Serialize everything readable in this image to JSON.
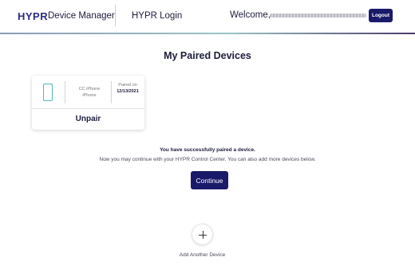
{
  "header": {
    "brand": "HYPR",
    "brand_subtitle": "Device Manager",
    "nav_link": "HYPR Login",
    "welcome": "Welcome,",
    "logout_label": "Logout"
  },
  "main": {
    "title": "My Paired Devices",
    "device": {
      "name": "CC iPhone",
      "model": "iPhone",
      "paired_label": "Paired on",
      "paired_date": "12/13/2021",
      "unpair_label": "Unpair",
      "icon": "phone-icon"
    },
    "success_title": "You have successfully paired a device.",
    "success_message": "Now you may continue with your HYPR Control Center. You can also add more devices below.",
    "continue_label": "Continue",
    "add_device_label": "Add Another Device",
    "add_icon": "plus-icon"
  },
  "colors": {
    "brand": "#2a2a8a",
    "primary_button": "#1a1a6b",
    "phone_icon": "#4fb8b4"
  }
}
